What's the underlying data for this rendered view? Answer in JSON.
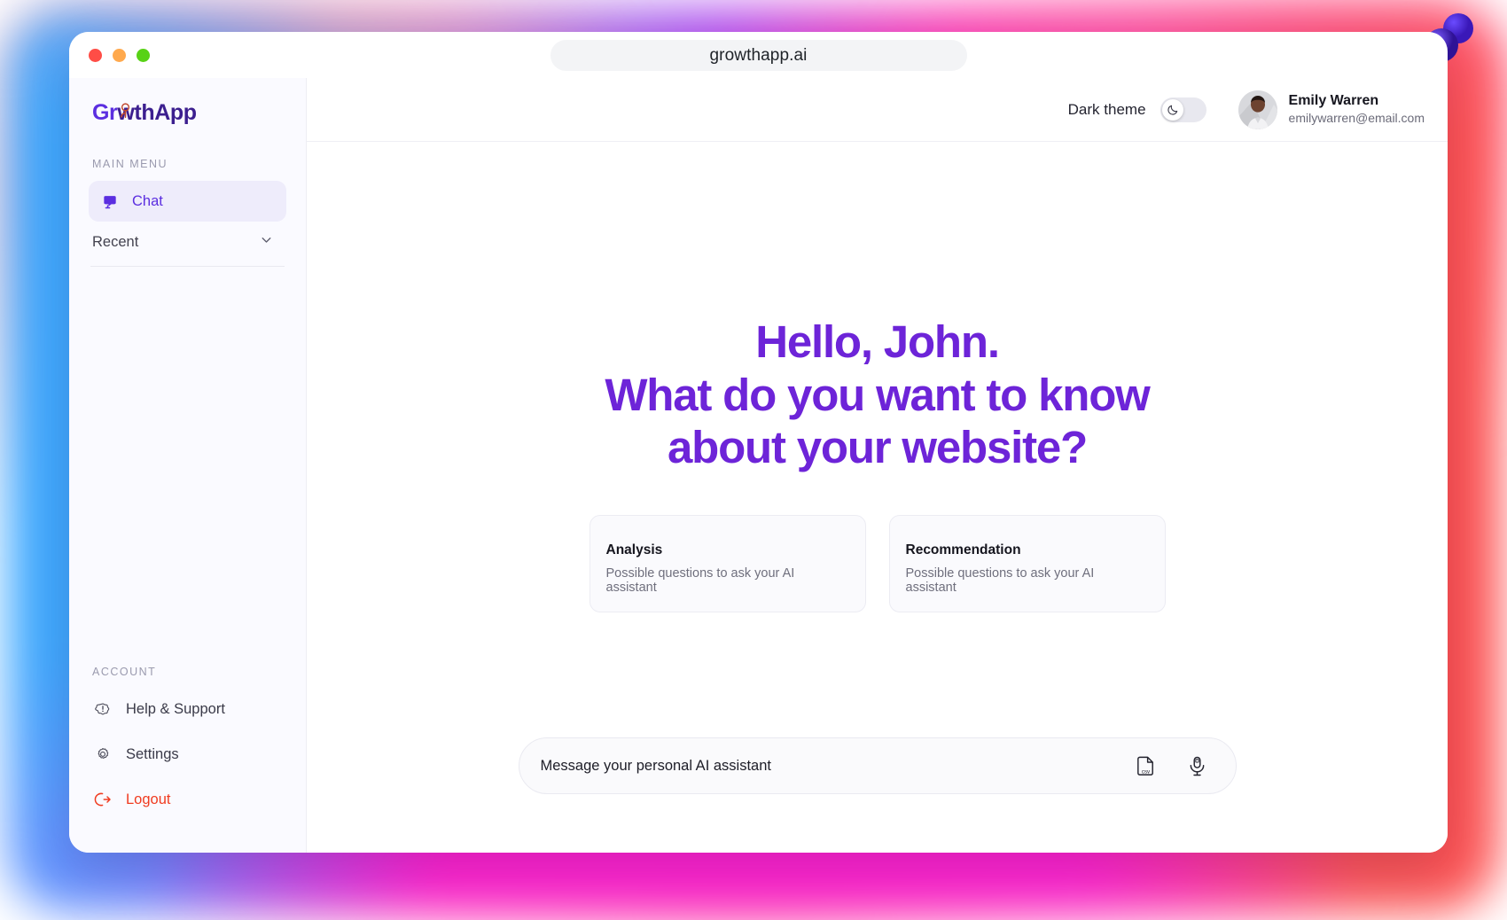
{
  "browser": {
    "url": "growthapp.ai",
    "traffic_lights": [
      "close",
      "minimize",
      "zoom"
    ]
  },
  "sidebar": {
    "logo": {
      "part1": "Gr",
      "part2": "wthApp",
      "mark_icon": "magnifier-person-icon"
    },
    "main_menu_label": "MAIN MENU",
    "items": [
      {
        "label": "Chat",
        "icon": "chat-bubble-icon",
        "active": true
      }
    ],
    "recent": {
      "label": "Recent",
      "icon": "chevron-down-icon"
    },
    "account_label": "ACCOUNT",
    "account_items": [
      {
        "label": "Help & Support",
        "icon": "help-badge-icon"
      },
      {
        "label": "Settings",
        "icon": "gear-icon"
      },
      {
        "label": "Logout",
        "icon": "logout-arrow-icon",
        "color": "#f03b20"
      }
    ]
  },
  "topbar": {
    "theme_label": "Dark theme",
    "theme_enabled": false,
    "theme_icon": "moon-icon",
    "profile": {
      "name": "Emily Warren",
      "email": "emilywarren@email.com",
      "avatar_icon": "user-avatar"
    }
  },
  "main": {
    "headline_line1": "Hello, John.",
    "headline_line2": "What do you want to know",
    "headline_line3": "about your website?",
    "cards": [
      {
        "title": "Analysis",
        "subtitle": "Possible questions to ask your AI assistant"
      },
      {
        "title": "Recommendation",
        "subtitle": "Possible questions to ask your AI assistant"
      }
    ],
    "composer": {
      "placeholder": "Message your personal AI assistant",
      "value": "",
      "actions": [
        {
          "icon": "csv-file-icon",
          "label": "csv"
        },
        {
          "icon": "microphone-icon",
          "label": "mic"
        }
      ]
    }
  },
  "colors": {
    "accent_purple": "#6d24d8",
    "logo_purple": "#5b2ee0",
    "danger_red": "#f03b20",
    "sidebar_bg": "#fafaff"
  },
  "decoration": {
    "pin_icon": "3d-pin-icon"
  }
}
